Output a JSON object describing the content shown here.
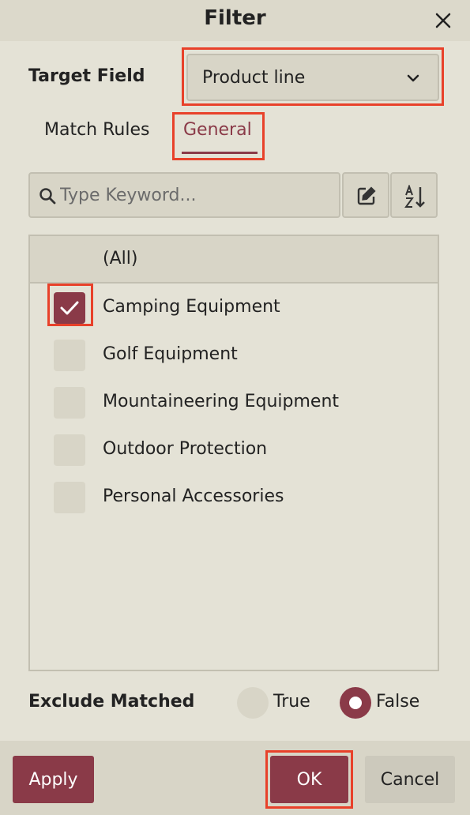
{
  "dialog": {
    "title": "Filter"
  },
  "target_field": {
    "label": "Target Field",
    "selected": "Product line"
  },
  "tabs": [
    {
      "label": "Match Rules",
      "active": false
    },
    {
      "label": "General",
      "active": true
    }
  ],
  "search": {
    "placeholder": "Type Keyword..."
  },
  "list": {
    "all_label": "(All)",
    "items": [
      {
        "label": "Camping Equipment",
        "checked": true
      },
      {
        "label": "Golf Equipment",
        "checked": false
      },
      {
        "label": "Mountaineering Equipment",
        "checked": false
      },
      {
        "label": "Outdoor Protection",
        "checked": false
      },
      {
        "label": "Personal Accessories",
        "checked": false
      }
    ]
  },
  "exclude": {
    "label": "Exclude Matched",
    "options": [
      {
        "label": "True",
        "selected": false
      },
      {
        "label": "False",
        "selected": true
      }
    ]
  },
  "footer": {
    "apply_label": "Apply",
    "ok_label": "OK",
    "cancel_label": "Cancel"
  },
  "colors": {
    "accent": "#8a3a48",
    "highlight": "#e8412a",
    "background": "#e4e2d6"
  },
  "icons": {
    "close": "close-icon",
    "dropdown": "chevron-down-icon",
    "search": "search-icon",
    "edit": "edit-icon",
    "sort": "sort-az-icon",
    "check": "checkmark-icon"
  }
}
